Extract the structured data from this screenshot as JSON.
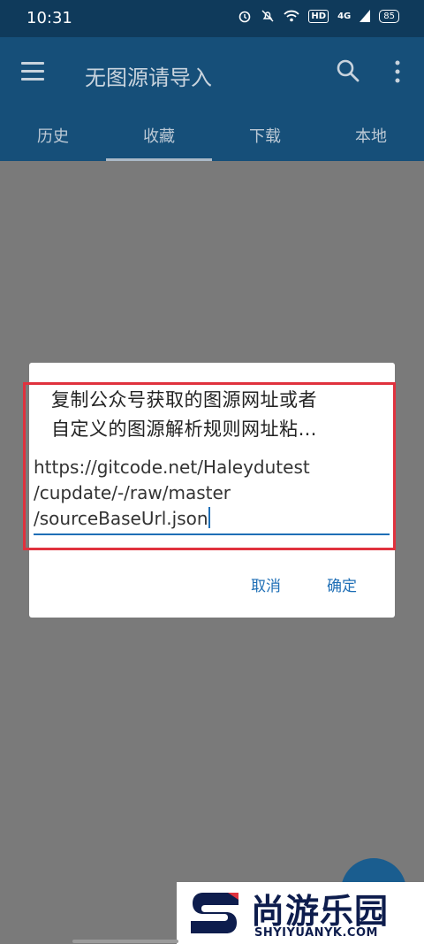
{
  "status_bar": {
    "time": "10:31",
    "hd": "HD",
    "signal": "4G",
    "battery": "85"
  },
  "appbar": {
    "title": "无图源请导入",
    "tabs": [
      {
        "label": "历史"
      },
      {
        "label": "收藏"
      },
      {
        "label": "下载"
      },
      {
        "label": "本地"
      }
    ],
    "active_tab": 1
  },
  "dialog": {
    "title_line1": "复制公众号获取的图源网址或者",
    "title_line2": "自定义的图源解析规则网址粘…",
    "url_line1": "https://gitcode.net/Haleydutest",
    "url_line2": "/cupdate/-/raw/master",
    "url_line3": "/sourceBaseUrl.json",
    "cancel_label": "取消",
    "ok_label": "确定"
  },
  "watermark": {
    "name": "尚游乐园",
    "domain": "SHYIYUANYK.COM"
  },
  "colors": {
    "appbar": "#164f79",
    "accent": "#1f6fb6",
    "highlight": "#e0323e"
  }
}
